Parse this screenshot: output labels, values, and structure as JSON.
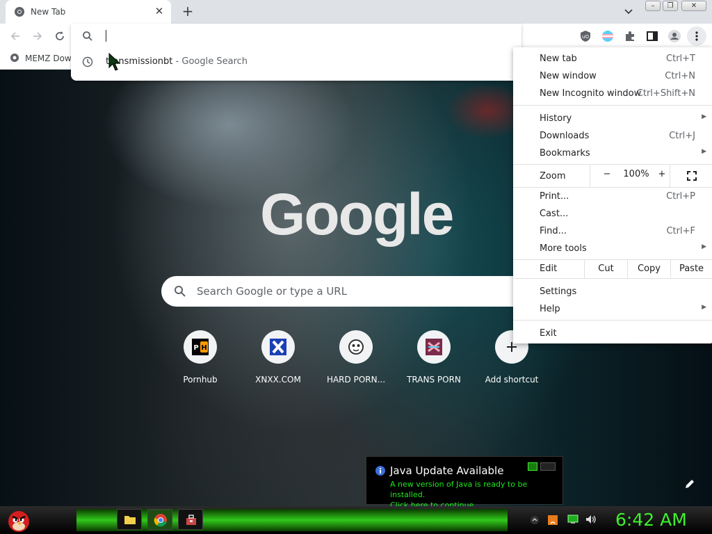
{
  "browser": {
    "tab": {
      "title": "New Tab",
      "favicon": "chrome-icon",
      "close_icon": "close-icon"
    },
    "newtab_icon": "plus-icon",
    "tabsearch_icon": "chevron-down-icon",
    "window_controls": [
      "minimize-icon",
      "restore-icon",
      "close-icon"
    ],
    "nav": [
      "back-arrow-icon",
      "forward-arrow-icon",
      "reload-icon"
    ],
    "bookmark": {
      "label": "MEMZ Dow"
    },
    "extensions": [
      "ublock-icon",
      "trans-flag-icon",
      "puzzle-icon",
      "sidepanel-icon",
      "profile-icon",
      "kebab-menu-icon"
    ]
  },
  "omnibox": {
    "value": "",
    "suggestion": {
      "text": "transmissionbt",
      "separator": " - ",
      "source": "Google Search"
    }
  },
  "ntp": {
    "logo": "Google",
    "search_placeholder": "Search Google or type a URL",
    "shortcuts": [
      {
        "title": "Pornhub",
        "icon": "ph-icon"
      },
      {
        "title": "XNXX.COM",
        "icon": "x-icon"
      },
      {
        "title": "HARD PORN...",
        "icon": "face-icon"
      },
      {
        "title": "TRANS PORN",
        "icon": "trans-icon"
      },
      {
        "title": "Add shortcut",
        "icon": "plus-icon"
      }
    ]
  },
  "menu": {
    "new_tab": {
      "label": "New tab",
      "shortcut": "Ctrl+T"
    },
    "new_window": {
      "label": "New window",
      "shortcut": "Ctrl+N"
    },
    "incognito": {
      "label": "New Incognito window",
      "shortcut": "Ctrl+Shift+N"
    },
    "history": {
      "label": "History"
    },
    "downloads": {
      "label": "Downloads",
      "shortcut": "Ctrl+J"
    },
    "bookmarks": {
      "label": "Bookmarks"
    },
    "zoom": {
      "label": "Zoom",
      "minus": "−",
      "value": "100%",
      "plus": "+"
    },
    "print": {
      "label": "Print...",
      "shortcut": "Ctrl+P"
    },
    "cast": {
      "label": "Cast..."
    },
    "find": {
      "label": "Find...",
      "shortcut": "Ctrl+F"
    },
    "more_tools": {
      "label": "More tools"
    },
    "edit": {
      "label": "Edit",
      "cut": "Cut",
      "copy": "Copy",
      "paste": "Paste"
    },
    "settings": {
      "label": "Settings"
    },
    "help": {
      "label": "Help"
    },
    "exit": {
      "label": "Exit"
    }
  },
  "java": {
    "title": "Java Update Available",
    "line1": "A new version of Java is ready to be installed.",
    "line2": "Click here to continue."
  },
  "taskbar": {
    "start_icon": "angry-bird-icon",
    "apps": [
      "folder-icon",
      "chrome-icon",
      "toolbox-icon"
    ],
    "tray": [
      "up-arrow-icon",
      "java-icon",
      "network-icon",
      "volume-icon"
    ],
    "clock": "6:42 AM"
  },
  "colors": {
    "accent": "#31c81a",
    "clock": "#3df02d",
    "java_text": "#1ee81e"
  }
}
